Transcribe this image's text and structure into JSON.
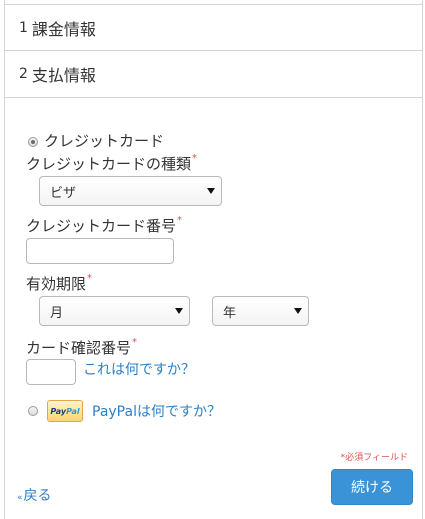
{
  "steps": [
    {
      "number": "1",
      "title": "課金情報"
    },
    {
      "number": "2",
      "title": "支払情報"
    }
  ],
  "payment": {
    "credit_card_option": "クレジットカード",
    "card_type_label": "クレジットカードの種類",
    "card_type_value": "ビザ",
    "card_number_label": "クレジットカード番号",
    "card_number_value": "",
    "expiry_label": "有効期限",
    "month_value": "月",
    "year_value": "年",
    "cvv_label": "カード確認番号",
    "cvv_value": "",
    "cvv_help_link": "これは何ですか？",
    "paypal_badge_part1": "Pay",
    "paypal_badge_part2": "Pal",
    "paypal_help_link": "PayPalは何ですか？",
    "required_asterisk": "*"
  },
  "footer": {
    "required_note": "*必須フィールド",
    "back_link": "戻る",
    "back_chevron": "«",
    "continue_button": "続ける"
  },
  "colors": {
    "link": "#2e7fc6",
    "button": "#3a93d7",
    "required": "#d9534f"
  }
}
